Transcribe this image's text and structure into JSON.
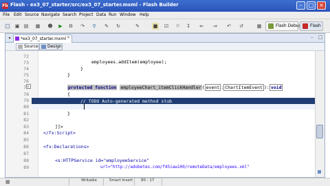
{
  "window": {
    "title": "Flash - ex3_07_starter/src/ex3_07_starter.mxml - Flash Builder",
    "app_icon": "Fb",
    "controls": [
      "minimize-icon",
      "maximize-icon",
      "close-icon"
    ]
  },
  "menu": [
    "File",
    "Edit",
    "Source",
    "Navigate",
    "Search",
    "Project",
    "Data",
    "Run",
    "Window",
    "Help"
  ],
  "perspectives": {
    "debug": "Flash Debug",
    "flash": "Flash"
  },
  "editor": {
    "tab": "*ex3_07_starter.mxml",
    "modes": {
      "source": "Source",
      "design": "Design"
    },
    "lines": [
      {
        "n": "72",
        "text": "employees.addItem(employee);"
      },
      {
        "n": "73",
        "text": "}"
      },
      {
        "n": "74",
        "text": "}"
      },
      {
        "n": "75",
        "text": ""
      },
      {
        "n": "76",
        "text": ""
      },
      {
        "n": "77",
        "kw": "protected function",
        "fn": "employeeChart_itemClickHandler",
        "arg": "event",
        "argtype": "ChartItemEvent",
        "ret": "void"
      },
      {
        "n": "78",
        "text": "{"
      },
      {
        "n": "79",
        "text": "// TODO Auto-generated method stub"
      },
      {
        "n": "80",
        "text": ""
      },
      {
        "n": "81",
        "text": "}"
      },
      {
        "n": "82",
        "text": ""
      },
      {
        "n": "83",
        "text": "]]>"
      },
      {
        "n": "84",
        "text": "</fx:Script>"
      },
      {
        "n": "85",
        "text": ""
      },
      {
        "n": "86",
        "text": "<fx:Declarations>"
      },
      {
        "n": "87",
        "text": ""
      },
      {
        "n": "88",
        "text": "<s:HTTPService id=\"employeeService\""
      },
      {
        "n": "89",
        "text": "url=\"http://adobetes.com/f45iaw100/remoteData/employees.xml\""
      }
    ]
  },
  "status": {
    "mode": "Writable",
    "insert": "Smart Insert",
    "position": "80 : 17"
  }
}
